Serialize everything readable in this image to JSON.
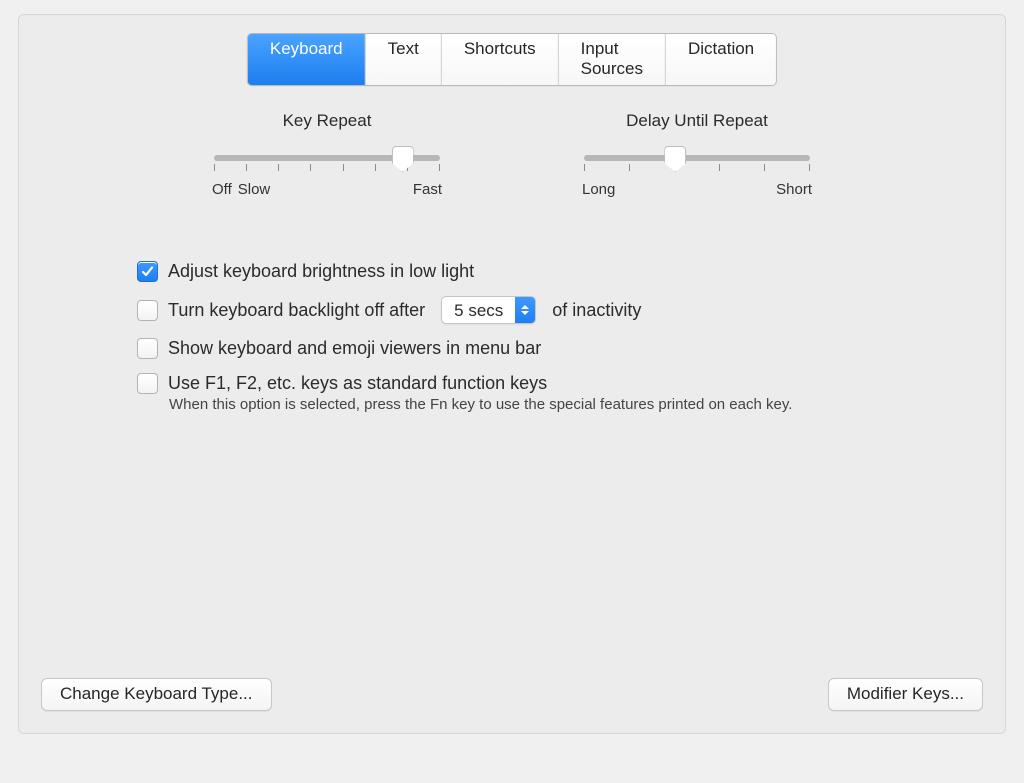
{
  "tabs": {
    "keyboard": "Keyboard",
    "text": "Text",
    "shortcuts": "Shortcuts",
    "input_sources": "Input Sources",
    "dictation": "Dictation"
  },
  "sliders": {
    "key_repeat": {
      "title": "Key Repeat",
      "left_label_off": "Off",
      "left_label_slow": "Slow",
      "right_label": "Fast",
      "tick_count": 8,
      "value_percent": 83
    },
    "delay_until_repeat": {
      "title": "Delay Until Repeat",
      "left_label": "Long",
      "right_label": "Short",
      "tick_count": 6,
      "value_percent": 40
    }
  },
  "checks": {
    "adjust_brightness": {
      "checked": true,
      "label": "Adjust keyboard brightness in low light"
    },
    "backlight_off": {
      "checked": false,
      "label_before": "Turn keyboard backlight off after",
      "select_value": "5 secs",
      "label_after": "of inactivity"
    },
    "show_viewers": {
      "checked": false,
      "label": "Show keyboard and emoji viewers in menu bar"
    },
    "function_keys": {
      "checked": false,
      "label": "Use F1, F2, etc. keys as standard function keys",
      "hint": "When this option is selected, press the Fn key to use the special features printed on each key."
    }
  },
  "buttons": {
    "change_type": "Change Keyboard Type...",
    "modifier_keys": "Modifier Keys..."
  }
}
